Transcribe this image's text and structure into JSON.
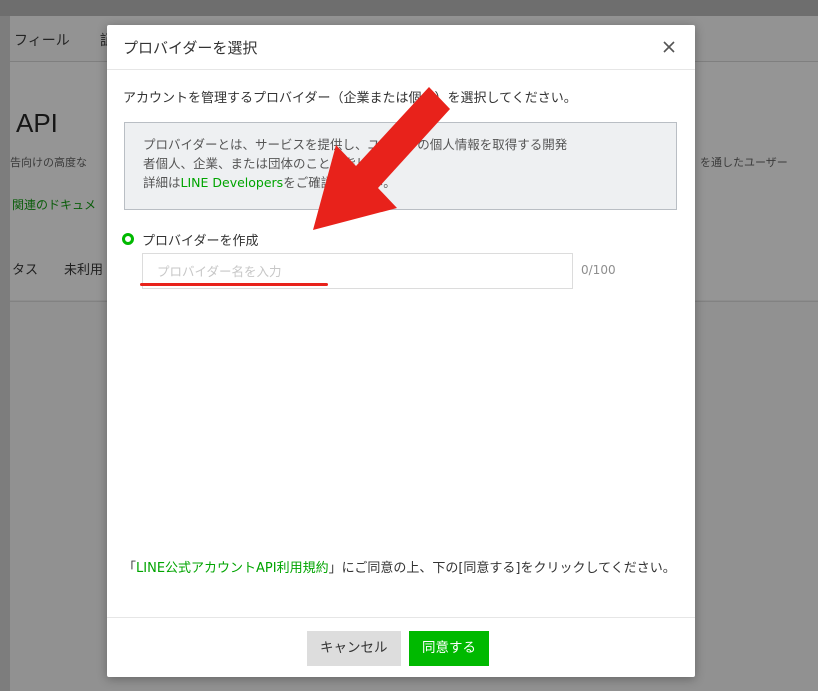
{
  "background_page": {
    "nav_items": [
      "フィール",
      "証"
    ],
    "api_title": "API",
    "description_left": "告向けの高度な",
    "description_right": "を通したユーザー",
    "doc_link": "関連のドキュメ",
    "tabs": [
      "タス",
      "未利用"
    ]
  },
  "modal": {
    "title": "プロバイダーを選択",
    "close_icon": "close-icon",
    "intro_text": "アカウントを管理するプロバイダー（企業または個人）を選択してください。",
    "info_line1": "プロバイダーとは、サービスを提供し、ユーザーの個人情報を取得する開発",
    "info_line2": "者個人、企業、または団体のことを指します。",
    "info_line3_prefix": "詳細は",
    "info_link": "LINE Developers",
    "info_line3_suffix": "をご確認ください。",
    "radio_label": "プロバイダーを作成",
    "input_placeholder": "プロバイダー名を入力",
    "input_value": "",
    "char_count": "0/100",
    "agreement_open": "「",
    "agreement_link": "LINE公式アカウントAPI利用規約",
    "agreement_rest": "」にご同意の上、下の[同意する]をクリックしてください。",
    "cancel_label": "キャンセル",
    "agree_label": "同意する"
  },
  "colors": {
    "accent_green": "#00b900",
    "link_green": "#00a400",
    "annotation_red": "#e8221b"
  }
}
